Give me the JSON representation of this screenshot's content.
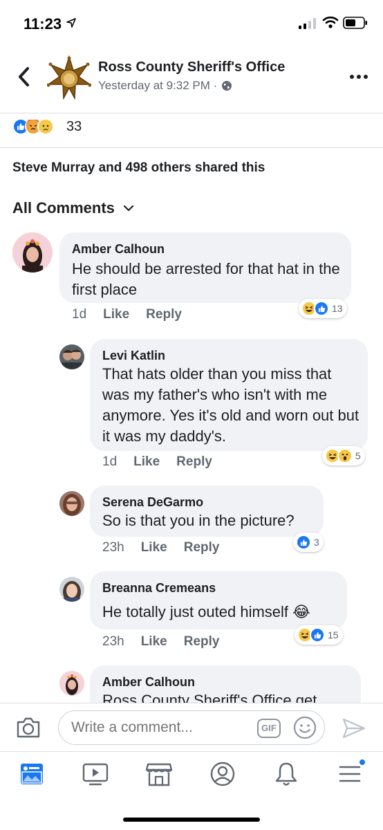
{
  "status_bar": {
    "time": "11:23"
  },
  "header": {
    "page_name": "Ross County Sheriff's Office",
    "post_time": "Yesterday at 9:32 PM ·"
  },
  "reactions": {
    "count": "33",
    "types": [
      "like",
      "angry",
      "sad"
    ]
  },
  "shares": {
    "text": "Steve Murray and 498 others shared this"
  },
  "comments_filter": {
    "label": "All Comments"
  },
  "comments": [
    {
      "author": "Amber Calhoun",
      "text": "He should be arrested for that hat in the first place",
      "time": "1d",
      "like_label": "Like",
      "reply_label": "Reply",
      "reaction_count": "13",
      "reactions": [
        "haha",
        "like"
      ]
    },
    {
      "author": "Levi Katlin",
      "text": "That hats older than you miss that was my father's who isn't with me anymore. Yes it's old and worn out but it was my daddy's.",
      "time": "1d",
      "like_label": "Like",
      "reply_label": "Reply",
      "reaction_count": "5",
      "reactions": [
        "haha",
        "wow"
      ]
    },
    {
      "author": "Serena DeGarmo",
      "text": "So is that you in the picture?",
      "time": "23h",
      "like_label": "Like",
      "reply_label": "Reply",
      "reaction_count": "3",
      "reactions": [
        "like"
      ]
    },
    {
      "author": "Breanna Cremeans",
      "text": "He totally just outed himself 😂",
      "time": "23h",
      "like_label": "Like",
      "reply_label": "Reply",
      "reaction_count": "15",
      "reactions": [
        "haha",
        "like"
      ]
    },
    {
      "author": "Amber Calhoun",
      "text": "Ross County Sheriff's Office get"
    }
  ],
  "composer": {
    "placeholder": "Write a comment...",
    "gif_label": "GIF"
  },
  "tab_bar": {
    "items": [
      "news-feed",
      "watch",
      "marketplace",
      "profile",
      "notifications",
      "menu"
    ]
  },
  "colors": {
    "accent": "#1877f2",
    "bubble": "#f0f2f5",
    "secondary_text": "#606770"
  }
}
